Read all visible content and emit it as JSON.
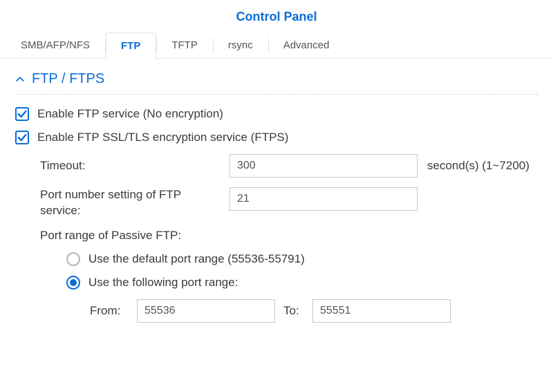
{
  "title": "Control Panel",
  "tabs": [
    {
      "label": "SMB/AFP/NFS"
    },
    {
      "label": "FTP"
    },
    {
      "label": "TFTP"
    },
    {
      "label": "rsync"
    },
    {
      "label": "Advanced"
    }
  ],
  "active_tab_index": 1,
  "section": {
    "title": "FTP / FTPS",
    "enable_ftp_label": "Enable FTP service (No encryption)",
    "enable_ftp_checked": true,
    "enable_ftps_label": "Enable FTP SSL/TLS encryption service (FTPS)",
    "enable_ftps_checked": true,
    "timeout": {
      "label": "Timeout:",
      "value": "300",
      "suffix": "second(s) (1~7200)"
    },
    "port": {
      "label": "Port number setting of FTP service:",
      "value": "21"
    },
    "passive": {
      "label": "Port range of Passive FTP:",
      "option_default": "Use the default port range (55536-55791)",
      "option_custom": "Use the following port range:",
      "selected": "custom",
      "from_label": "From:",
      "from_value": "55536",
      "to_label": "To:",
      "to_value": "55551"
    }
  }
}
